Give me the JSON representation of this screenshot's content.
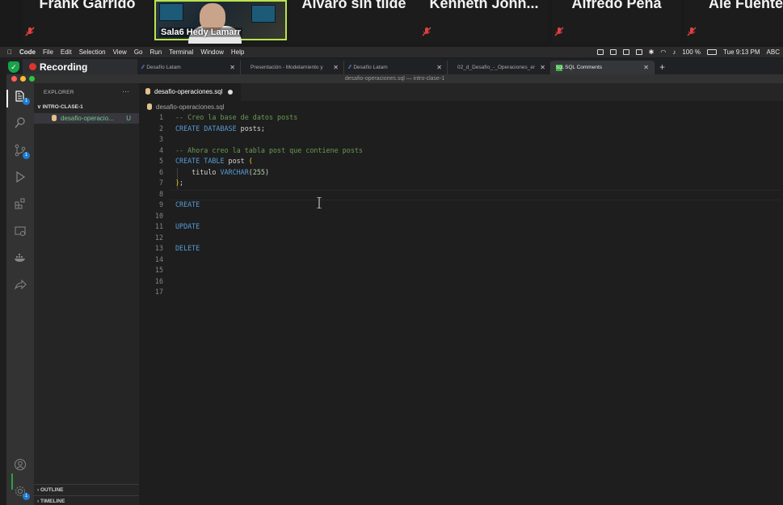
{
  "zoom": {
    "participants": [
      {
        "name": "Frank Garrido",
        "muted": true
      },
      {
        "name": "Sala6 Hedy Lamarr",
        "muted": true,
        "video": true
      },
      {
        "name": "Alvaro sin tilde",
        "muted": true
      },
      {
        "name": "Kenneth John...",
        "muted": true
      },
      {
        "name": "Alfredo Peña",
        "muted": true
      },
      {
        "name": "Ale Fuente",
        "muted": true
      }
    ]
  },
  "menubar": {
    "app": "Code",
    "items": [
      "File",
      "Edit",
      "Selection",
      "View",
      "Go",
      "Run",
      "Terminal",
      "Window",
      "Help"
    ],
    "battery": "100 %",
    "clock": "Tue 9:13 PM",
    "input": "ABC"
  },
  "browser": {
    "recording_label": "Recording",
    "tabs": [
      {
        "label": "Desafío Latam",
        "active": false
      },
      {
        "label": "Presentación - Modelamiento y",
        "active": false
      },
      {
        "label": "Desafío Latam",
        "active": false
      },
      {
        "label": "02_d_Desafío_-_Operaciones_en",
        "active": false
      },
      {
        "label": "SQL Comments",
        "active": true
      }
    ],
    "new_tab": "+"
  },
  "vscode": {
    "window_title": "desafio-operaciones.sql — intro-clase-1",
    "explorer": {
      "title": "EXPLORER",
      "more": "···",
      "folder": "INTRO-CLASE-1",
      "file": "desafio-operacio...",
      "file_status": "U",
      "sections": [
        "OUTLINE",
        "TIMELINE"
      ]
    },
    "editor_tab": "desafio-operaciones.sql",
    "breadcrumb": "desafio-operaciones.sql",
    "activity_badges": {
      "explorer": "1",
      "scm": "1",
      "settings": "1"
    }
  },
  "code": {
    "line_numbers": [
      "1",
      "2",
      "3",
      "4",
      "5",
      "6",
      "7",
      "8",
      "9",
      "10",
      "11",
      "12",
      "13",
      "14",
      "15",
      "16",
      "17"
    ],
    "l1_comment": "-- Creo la base de datos posts",
    "l2_kw": "CREATE DATABASE",
    "l2_rest": " posts;",
    "l4_comment": "-- Ahora creo la tabla post que contiene posts",
    "l5_kw": "CREATE TABLE",
    "l5_rest": " post ",
    "l5_paren": "(",
    "l6_indent": "    titulo ",
    "l6_type": "VARCHAR",
    "l6_open": "(",
    "l6_num": "255",
    "l6_close": ")",
    "l7_paren": ")",
    "l7_rest": ";",
    "l9": "CREATE",
    "l11": "UPDATE",
    "l13": "DELETE"
  },
  "colors": {
    "keyword": "#569cd6",
    "comment": "#6a9955",
    "number": "#b5cea8",
    "bracket": "#ffd700",
    "video_border": "#b9e34d"
  }
}
